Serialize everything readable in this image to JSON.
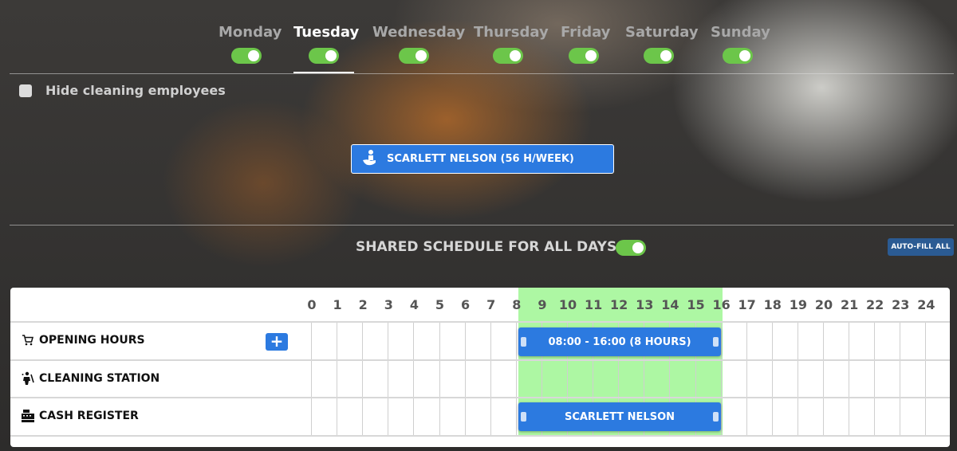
{
  "days": [
    {
      "label": "Monday",
      "enabled": true,
      "active": false
    },
    {
      "label": "Tuesday",
      "enabled": true,
      "active": true
    },
    {
      "label": "Wednesday",
      "enabled": true,
      "active": false
    },
    {
      "label": "Thursday",
      "enabled": true,
      "active": false
    },
    {
      "label": "Friday",
      "enabled": true,
      "active": false
    },
    {
      "label": "Saturday",
      "enabled": true,
      "active": false
    },
    {
      "label": "Sunday",
      "enabled": true,
      "active": false
    }
  ],
  "hide_cleaning": {
    "label": "Hide cleaning employees",
    "checked": false
  },
  "employee": {
    "label": "SCARLETT NELSON (56 H/WEEK)",
    "icon": "cleaning-person-icon"
  },
  "shared": {
    "label": "SHARED SCHEDULE FOR ALL DAYS",
    "enabled": true
  },
  "autofill_label": "AUTO-FILL ALL",
  "colors": {
    "toggle_on": "#6cc64a",
    "accent": "#2c7ae0",
    "highlight": "#adf7a3",
    "autofill": "#2b5b93"
  },
  "schedule": {
    "hours": [
      "0",
      "1",
      "2",
      "3",
      "4",
      "5",
      "6",
      "7",
      "8",
      "9",
      "10",
      "11",
      "12",
      "13",
      "14",
      "15",
      "16",
      "17",
      "18",
      "19",
      "20",
      "21",
      "22",
      "23",
      "24"
    ],
    "highlight_range": [
      8,
      16
    ],
    "rows": [
      {
        "label": "OPENING HOURS",
        "icon": "cart-icon",
        "add_label": "+",
        "bar": {
          "label": "08:00 - 16:00 (8 HOURS)",
          "start": 8,
          "end": 16
        }
      },
      {
        "label": "CLEANING STATION",
        "icon": "cleaning-icon"
      },
      {
        "label": "CASH REGISTER",
        "icon": "cash-register-icon",
        "bar": {
          "label": "SCARLETT NELSON",
          "start": 8,
          "end": 16
        }
      }
    ]
  }
}
